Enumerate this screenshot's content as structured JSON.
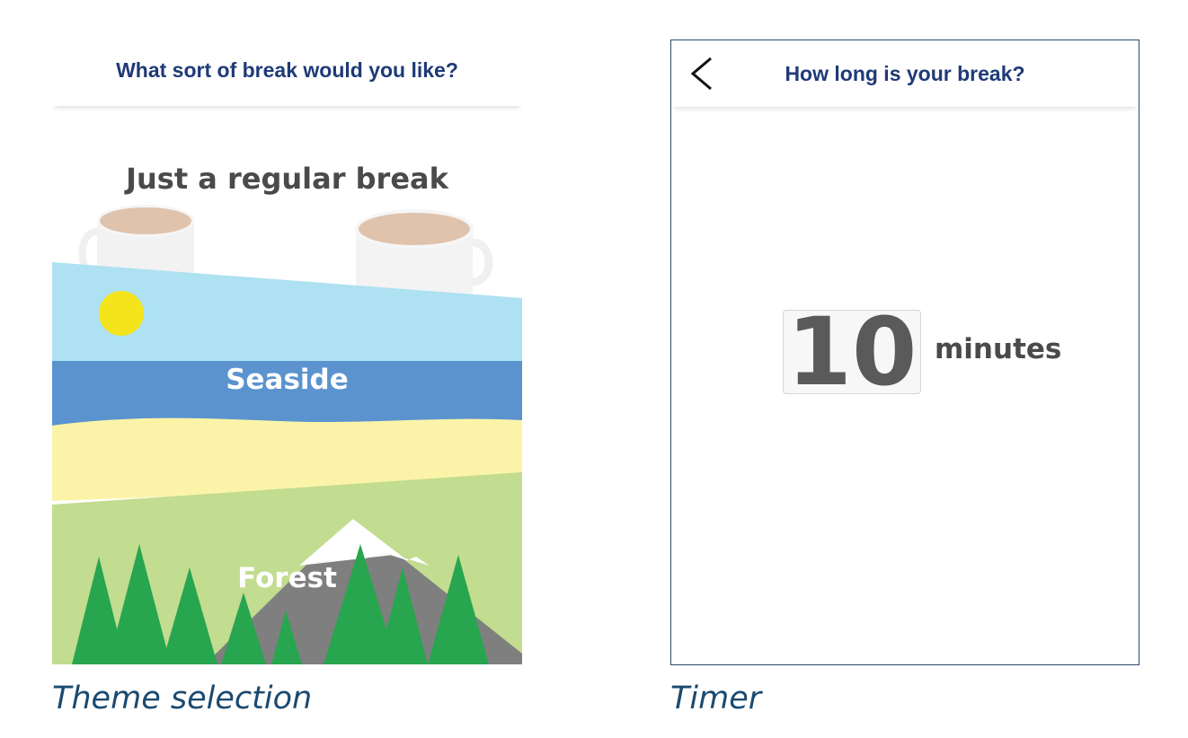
{
  "left": {
    "header_title": "What sort of break would you like?",
    "themes": [
      {
        "label": "Just a regular break"
      },
      {
        "label": "Seaside"
      },
      {
        "label": "Forest"
      }
    ],
    "caption": "Theme selection"
  },
  "right": {
    "header_title": "How long is your break?",
    "timer_value": "10",
    "timer_unit": "minutes",
    "caption": "Timer",
    "back_icon": "chevron-left-icon"
  },
  "colors": {
    "header_text": "#1f3a78",
    "caption_text": "#1b4a70",
    "sky": "#aee1f1",
    "sea": "#5b93cf",
    "sand": "#fbf4a8",
    "grass": "#c2dc90",
    "tree": "#28a54f",
    "mountain": "#7f7f7f",
    "sun": "#f3e41c"
  }
}
